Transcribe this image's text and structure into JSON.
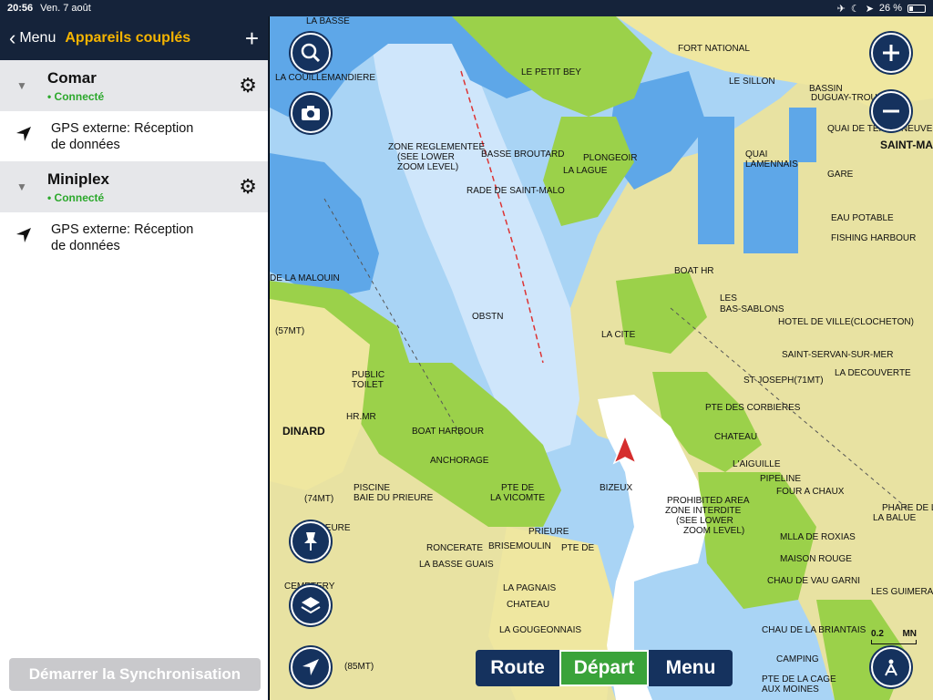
{
  "statusbar": {
    "time": "20:56",
    "date": "Ven. 7 août",
    "battery": "26 %"
  },
  "nav": {
    "back_label": "Menu",
    "title": "Appareils couplés"
  },
  "devices": [
    {
      "name": "Comar",
      "status": "• Connecté",
      "detail_line1": "GPS externe: Réception",
      "detail_line2": "de données"
    },
    {
      "name": "Miniplex",
      "status": "• Connecté",
      "detail_line1": "GPS externe: Réception",
      "detail_line2": "de données"
    }
  ],
  "sync_button": "Démarrer la Synchronisation",
  "bottom_bar": {
    "route": "Route",
    "depart": "Départ",
    "menu": "Menu"
  },
  "scale": {
    "value": "0.2",
    "unit": "MN"
  },
  "map_labels": {
    "la_basse": "LA BASSE",
    "couillemandiere": "LA COUILLEMANDIERE",
    "fort_national": "FORT NATIONAL",
    "le_petit_bey": "LE PETIT BEY",
    "le_sillon": "LE SILLON",
    "bassin": "BASSIN",
    "duguay": "DUGUAY-TROUIN",
    "quai_terre_neuve": "QUAI DE TERRE-NEUVE",
    "saint_malo": "SAINT-MA",
    "zone_reg_1": "ZONE REGLEMENTEE",
    "zone_reg_2": "(SEE LOWER",
    "zone_reg_3": "ZOOM LEVEL)",
    "basse_broutard": "BASSE BROUTARD",
    "plongeoir": "PLONGEOIR",
    "la_lague": "LA LAGUE",
    "quai_lamennais_1": "QUAI",
    "quai_lamennais_2": "LAMENNAIS",
    "gare": "GARE",
    "rade": "RADE DE SAINT-MALO",
    "eau_potable": "EAU POTABLE",
    "fishing_harbour": "FISHING HARBOUR",
    "boat_hr": "BOAT HR",
    "la_malouin": "DE LA MALOUIN",
    "les_bas_sablons_1": "LES",
    "les_bas_sablons_2": "BAS-SABLONS",
    "hotel_ville": "HOTEL DE VILLE(CLOCHETON)",
    "la_cite": "LA CITE",
    "st_servan": "SAINT-SERVAN-SUR-MER",
    "la_decouverte": "LA DECOUVERTE",
    "st_joseph": "ST JOSEPH(71MT)",
    "pte_corbieres": "PTE DES CORBIERES",
    "dinard": "DINARD",
    "hr_mr": "HR.MR",
    "public_toilet_1": "PUBLIC",
    "public_toilet_2": "TOILET",
    "boat_harbour": "BOAT HARBOUR",
    "chateau": "CHATEAU",
    "l_aiguille": "L'AIGUILLE",
    "pipeline": "PIPELINE",
    "four_a_chaux": "FOUR A CHAUX",
    "anchorage": "ANCHORAGE",
    "piscine": "PISCINE",
    "baie_prieure": "BAIE DU PRIEURE",
    "pte_vicomte_1": "PTE DE",
    "pte_vicomte_2": "LA VICOMTE",
    "bizeux": "BIZEUX",
    "prohibited_1": "PROHIBITED AREA",
    "prohibited_2": "ZONE INTERDITE",
    "prohibited_3": "(SEE LOWER",
    "prohibited_4": "ZOOM LEVEL)",
    "phare_1": "PHARE DE L",
    "phare_2": "LA BALUE",
    "prieure": "PRIEURE",
    "roncerate": "RONCERATE",
    "brisemoulin": "BRISEMOULIN",
    "pte_de": "PTE DE",
    "roxias": "MLLA DE ROXIAS",
    "maison_rouge": "MAISON ROUGE",
    "la_basse_guais": "LA BASSE GUAIS",
    "chau_vau_garni": "CHAU DE VAU GARNI",
    "les_guimerais": "LES GUIMERAIS",
    "cemetery": "CEMETERY",
    "la_pagnais": "LA PAGNAIS",
    "chateau2": "CHATEAU",
    "chau_briantais": "CHAU DE LA BRIANTAIS",
    "la_goguenais": "LA GOUGEONNAIS",
    "camping": "CAMPING",
    "pte_cage_1": "PTE DE LA CAGE",
    "pte_cage_2": "AUX MOINES",
    "ieure": "IEURE",
    "mt_57": "(57MT)",
    "mt_74": "(74MT)",
    "mt_85": "(85MT)",
    "obstn": "OBSTN"
  }
}
